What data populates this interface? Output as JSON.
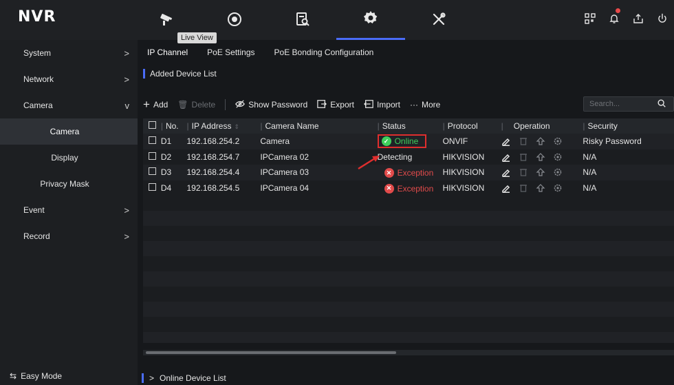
{
  "app": {
    "logo": "NVR"
  },
  "tooltip": "Live View",
  "topnav": [
    {
      "icon": "live-view-camera-icon",
      "active": false
    },
    {
      "icon": "playback-icon",
      "active": false
    },
    {
      "icon": "file-search-icon",
      "active": false
    },
    {
      "icon": "settings-gear-icon",
      "active": true
    },
    {
      "icon": "maintenance-tools-icon",
      "active": false
    }
  ],
  "sidebar": {
    "items": [
      {
        "label": "System",
        "chevron": ">"
      },
      {
        "label": "Network",
        "chevron": ">"
      },
      {
        "label": "Camera",
        "chevron": "v"
      },
      {
        "label": "Camera"
      },
      {
        "label": "Display"
      },
      {
        "label": "Privacy Mask"
      },
      {
        "label": "Event",
        "chevron": ">"
      },
      {
        "label": "Record",
        "chevron": ">"
      }
    ],
    "easy_mode": "Easy Mode"
  },
  "tabs": [
    "IP Channel",
    "PoE Settings",
    "PoE Bonding Configuration"
  ],
  "section_title": "Added Device List",
  "toolbar": {
    "add": "Add",
    "delete": "Delete",
    "show_password": "Show Password",
    "export": "Export",
    "import": "Import",
    "more": "More",
    "search_placeholder": "Search..."
  },
  "table": {
    "headers": [
      "No.",
      "IP Address",
      "Camera Name",
      "Status",
      "Protocol",
      "Operation",
      "Security"
    ],
    "rows": [
      {
        "no": "D1",
        "ip": "192.168.254.2",
        "name": "Camera",
        "status": "Online",
        "protocol": "ONVIF",
        "security": "Risky Password"
      },
      {
        "no": "D2",
        "ip": "192.168.254.7",
        "name": "IPCamera 02",
        "status": "Detecting",
        "protocol": "HIKVISION",
        "security": "N/A"
      },
      {
        "no": "D3",
        "ip": "192.168.254.4",
        "name": "IPCamera 03",
        "status": "Exception",
        "protocol": "HIKVISION",
        "security": "N/A"
      },
      {
        "no": "D4",
        "ip": "192.168.254.5",
        "name": "IPCamera 04",
        "status": "Exception",
        "protocol": "HIKVISION",
        "security": "N/A"
      }
    ]
  },
  "online_list": {
    "chevron": ">",
    "label": "Online Device List"
  },
  "colors": {
    "accent": "#4a6cf7",
    "online": "#3fcf5c",
    "exception": "#e24b4b",
    "highlight": "#e02e2e"
  }
}
